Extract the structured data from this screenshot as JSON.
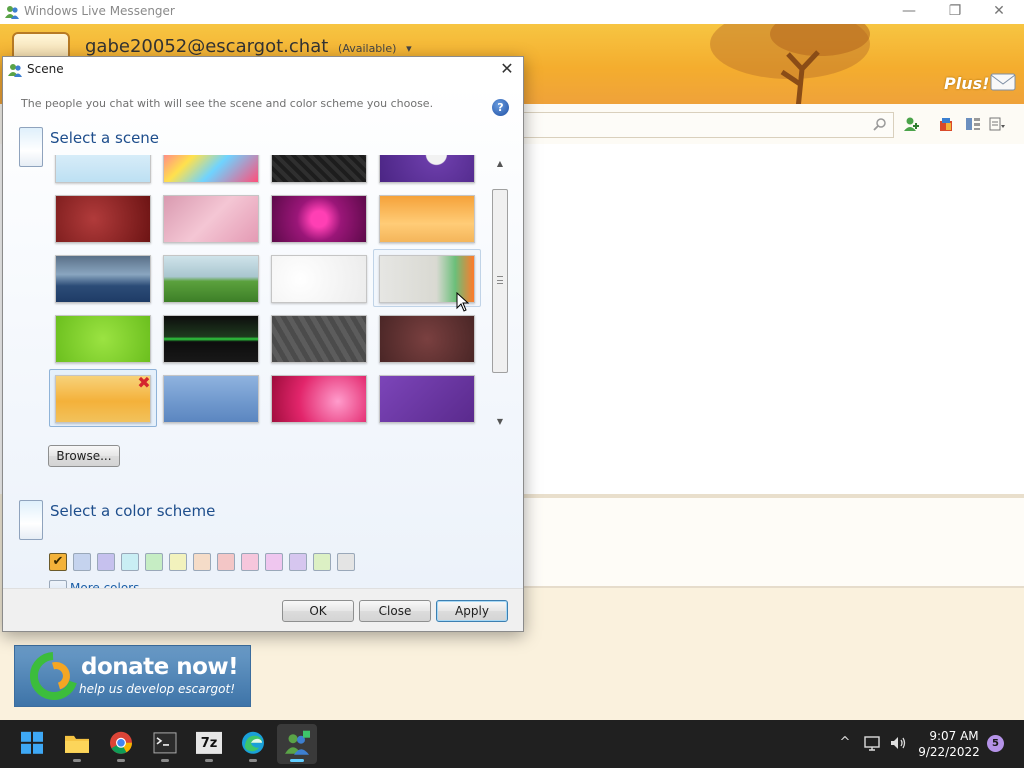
{
  "window": {
    "title": "Windows Live Messenger",
    "controls": {
      "minimize": "—",
      "maximize": "❐",
      "close": "✕"
    }
  },
  "user": {
    "email": "gabe20052@escargot.chat",
    "status": "(Available)",
    "status_arrow": "▾"
  },
  "plus_logo": "Plus!",
  "donate": {
    "main": "donate now!",
    "sub": "help us develop escargot!"
  },
  "dialog": {
    "title": "Scene",
    "close_glyph": "✕",
    "description": "The people you chat with will see the scene and color scheme you choose.",
    "help_glyph": "?",
    "scene_heading": "Select a scene",
    "color_heading": "Select a color scheme",
    "browse_label": "Browse...",
    "more_colors_label": "More colors...",
    "remove_glyph": "✖",
    "buttons": {
      "ok": "OK",
      "close": "Close",
      "apply": "Apply"
    },
    "scrollbar": {
      "up": "▲",
      "down": "▼"
    },
    "scenes": [
      {
        "name": "sky",
        "bg": "linear-gradient(180deg,#e9f5fc,#bde0f3)"
      },
      {
        "name": "pop-swirls",
        "bg": "linear-gradient(135deg,#ff5aa8 0%,#ffe14d 35%,#6fd3ff 60%,#ff4f7a 100%)"
      },
      {
        "name": "dark-pattern",
        "bg": "repeating-linear-gradient(45deg,#1d1d1d 0 4px,#2f2f2f 4px 8px)"
      },
      {
        "name": "skull",
        "bg": "radial-gradient(circle at 60% 40%,#f2f2f2 0 10px,#6a3ca8 11px,#4b2584 100%)"
      },
      {
        "name": "love",
        "bg": "radial-gradient(circle at 40% 50%,#b13b3b,#6d1414)"
      },
      {
        "name": "pink-lace",
        "bg": "linear-gradient(135deg,#d99ab0,#f4c6d4 50%,#e49ab4)"
      },
      {
        "name": "magenta-flower",
        "bg": "radial-gradient(circle at 50% 50%,#ff3fb4 0 8px,#9a1678 22px,#5d0a4a 100%)"
      },
      {
        "name": "orange-grass",
        "bg": "linear-gradient(180deg,#f5a23a,#ffcc77 60%,#f4b55a)"
      },
      {
        "name": "plane-sea",
        "bg": "linear-gradient(180deg,#5a7088 0%,#8aa6c0 40%,#2c4c77 65%,#1e3b66 100%)"
      },
      {
        "name": "field",
        "bg": "linear-gradient(180deg,#cfe3ea 0%,#a9c6cf 45%,#5ba13d 55%,#3d7f27 100%)"
      },
      {
        "name": "white-circles",
        "bg": "radial-gradient(circle at 30% 50%,#ffffff,#ececec)"
      },
      {
        "name": "chameleon",
        "bg": "linear-gradient(90deg,#e6e6e3 0%,#d9d9d2 60%,#6bbf7a 80%,#ff7a2a 100%)"
      },
      {
        "name": "lime-dots",
        "bg": "radial-gradient(circle,#9be342,#6bbf1e)"
      },
      {
        "name": "dark-green",
        "bg": "linear-gradient(180deg,#0d0d0d 0%,#1e3a1e 45%,#2fd03f 50%,#0d0d0d 56%,#181818 100%)"
      },
      {
        "name": "hex-grey",
        "bg": "repeating-linear-gradient(60deg,#4b4b4b 0 5px,#5c5c5c 5px 10px)"
      },
      {
        "name": "brown-swirl",
        "bg": "radial-gradient(circle at 50% 50%,#7a4040,#4a2626)"
      },
      {
        "name": "autumn-tree",
        "bg": "linear-gradient(180deg,#f7d27a 0%,#f4b13a 55%,#f2c25c 100%)"
      },
      {
        "name": "blue-mountains",
        "bg": "linear-gradient(180deg,#8fb3df 0%,#6e97cc 60%,#5b86c0 100%)"
      },
      {
        "name": "pink-burst",
        "bg": "radial-gradient(circle at 70% 55%,#ff9ccc,#e2256b 55%,#9e0d3c)"
      },
      {
        "name": "purple-floral",
        "bg": "linear-gradient(135deg,#7c45b9,#5a2a8d)"
      }
    ],
    "swatches": [
      {
        "name": "orange",
        "color": "#f3b23a",
        "selected": true,
        "check": "✔"
      },
      {
        "name": "blue",
        "color": "#c5d3ee"
      },
      {
        "name": "lavender",
        "color": "#c6c1ee"
      },
      {
        "name": "cyan",
        "color": "#c9eef4"
      },
      {
        "name": "green",
        "color": "#c6edc4"
      },
      {
        "name": "yellow",
        "color": "#f2f2bd"
      },
      {
        "name": "peach",
        "color": "#f5dcc8"
      },
      {
        "name": "salmon",
        "color": "#f3c6c6"
      },
      {
        "name": "pink",
        "color": "#f6c6dc"
      },
      {
        "name": "magenta",
        "color": "#efc6ef"
      },
      {
        "name": "purple",
        "color": "#d6c6ef"
      },
      {
        "name": "lime",
        "color": "#dcf0c4"
      },
      {
        "name": "grey",
        "color": "#e4e4e4"
      }
    ]
  },
  "taskbar": {
    "apps": [
      {
        "name": "start"
      },
      {
        "name": "file-explorer"
      },
      {
        "name": "chrome"
      },
      {
        "name": "terminal"
      },
      {
        "name": "7zip",
        "label": "7z"
      },
      {
        "name": "edge"
      },
      {
        "name": "messenger",
        "active": true
      }
    ],
    "tray": {
      "chevron": "^",
      "time": "9:07 AM",
      "date": "9/22/2022",
      "badge": "5"
    }
  }
}
